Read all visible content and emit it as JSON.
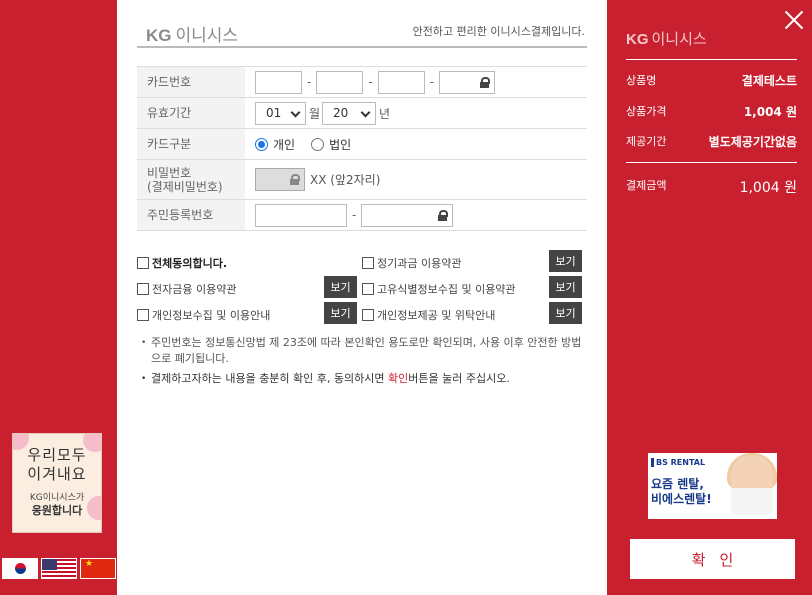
{
  "banner": {
    "line1": "우리모두",
    "line2": "이겨내요",
    "line3": "KG이니시스가",
    "line4": "응원합니다"
  },
  "flags": [
    "korean-flag-icon",
    "us-flag-icon",
    "china-flag-icon"
  ],
  "header": {
    "logo_kg": "KG",
    "logo_text": "이니시스",
    "tagline": "안전하고 편리한 이니시스결제입니다."
  },
  "form": {
    "card_number_label": "카드번호",
    "expiry_label": "유효기간",
    "expiry_month": "01",
    "month_unit": "월",
    "expiry_year": "20",
    "year_unit": "년",
    "card_type_label": "카드구분",
    "card_type_personal": "개인",
    "card_type_corporate": "법인",
    "card_type_selected": "개인",
    "password_label_1": "비밀번호",
    "password_label_2": "(결제비밀번호)",
    "password_hint": "XX (앞2자리)",
    "rrn_label": "주민등록번호",
    "dash": "-"
  },
  "agreements": {
    "all": "전체동의합니다.",
    "recurring": "정기과금 이용약관",
    "electronic_finance": "전자금융 이용약관",
    "unique_id": "고유식별정보수집 및 이용약관",
    "personal_info_collect": "개인정보수집 및 이용안내",
    "personal_info_provide": "개인정보제공 및 위탁안내",
    "view_label": "보기"
  },
  "notes": {
    "note1": "주민번호는 정보통신망법 제 23조에 따라 본인확인 용도로만 확인되며, 사용 이후 안전한 방법으로 폐기됩니다.",
    "note2_a": "결제하고자하는 내용을 충분히 확인 후, 동의하시면 ",
    "note2_red": "확인",
    "note2_b": "버튼을 눌러 주십시오."
  },
  "summary": {
    "logo_kg": "KG",
    "logo_text": "이니시스",
    "product_label": "상품명",
    "product_value": "결제테스트",
    "price_label": "상품가격",
    "price_value": "1,004 원",
    "period_label": "제공기간",
    "period_value": "별도제공기간없음",
    "total_label": "결제금액",
    "total_value": "1,004 원"
  },
  "ad": {
    "brand": "BS RENTAL",
    "line1": "요즘 렌탈,",
    "line2": "비에스렌탈!"
  },
  "confirm_label": "확인",
  "colors": {
    "brand_red": "#c8202f",
    "radio_blue": "#1a73e8"
  }
}
